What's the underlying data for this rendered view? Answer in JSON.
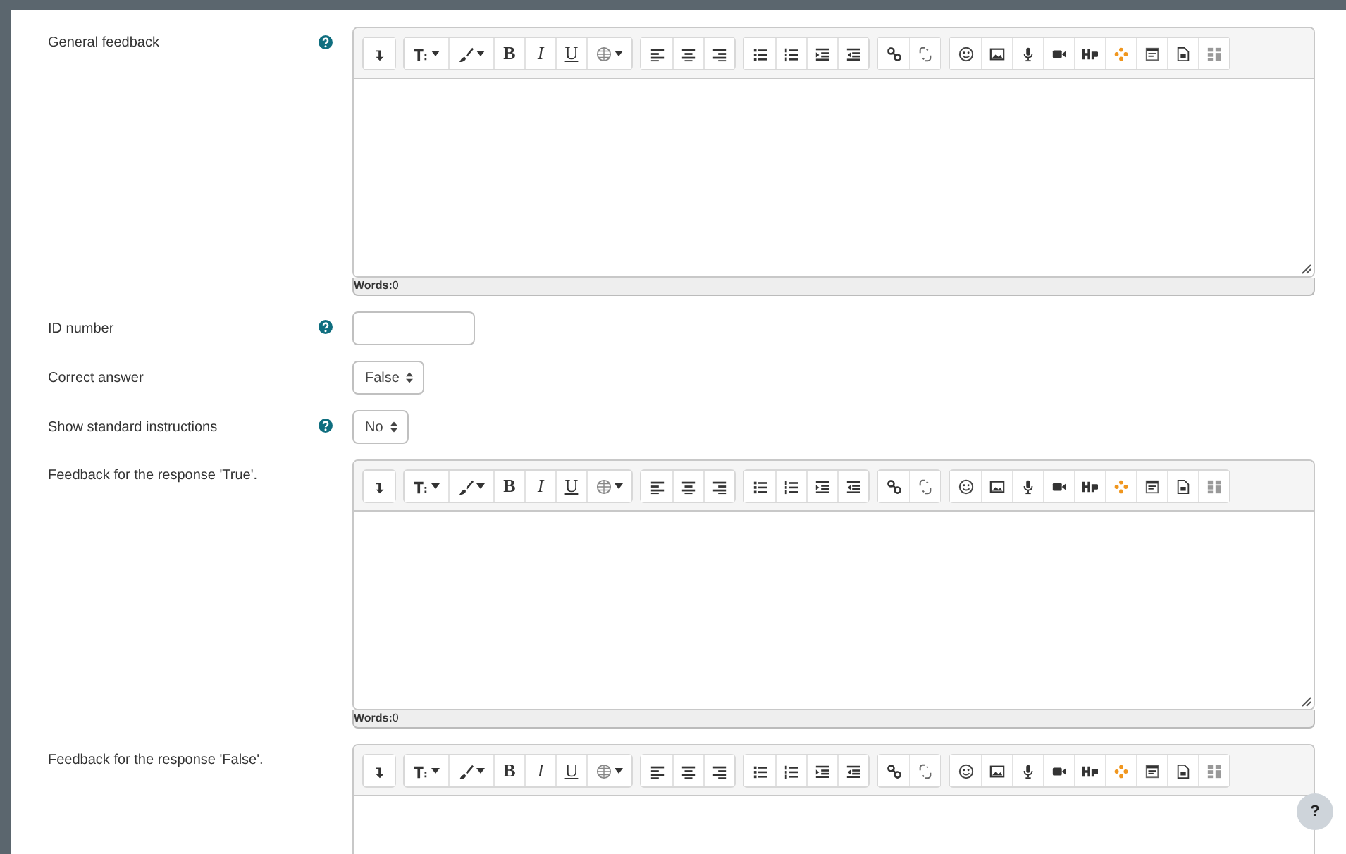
{
  "fields": [
    {
      "kind": "editor",
      "label": "General feedback",
      "help": true,
      "format_buttons": [
        "B",
        "I",
        "U"
      ],
      "word_count": "**Words:**0"
    },
    {
      "kind": "text",
      "label": "ID number",
      "help": true
    },
    {
      "kind": "select",
      "label": "Correct answer",
      "help": false,
      "value": "False"
    },
    {
      "kind": "select",
      "label": "Show standard instructions",
      "help": true,
      "value": "No"
    },
    {
      "kind": "editor",
      "label": "Feedback for the response 'True'.",
      "help": false,
      "format_buttons": [
        "B",
        "I",
        "U"
      ],
      "word_count": "**Words:**0"
    },
    {
      "kind": "editor",
      "label": "Feedback for the response 'False'.",
      "help": false,
      "format_buttons": [
        "B",
        "I",
        "U"
      ]
    }
  ],
  "help_button": "?"
}
